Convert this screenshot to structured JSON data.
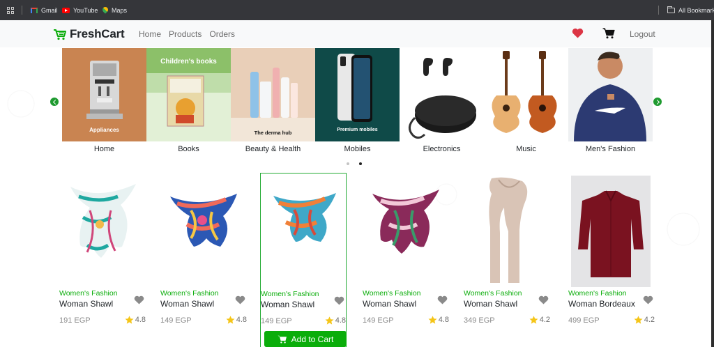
{
  "bookmarks_bar": {
    "items": [
      {
        "label": "Gmail",
        "icon": "gmail-icon"
      },
      {
        "label": "YouTube",
        "icon": "youtube-icon"
      },
      {
        "label": "Maps",
        "icon": "maps-icon"
      }
    ],
    "all_bookmarks": "All Bookmarks"
  },
  "navbar": {
    "brand": "FreshCart",
    "links": [
      "Home",
      "Products",
      "Orders"
    ],
    "logout": "Logout",
    "colors": {
      "brand": "#0aad0a",
      "heart": "#dc3545"
    }
  },
  "categories": {
    "items": [
      {
        "name": "Home",
        "image_caption": "Appliances"
      },
      {
        "name": "Books",
        "image_caption": "Children's books"
      },
      {
        "name": "Beauty & Health",
        "image_caption": "The derma hub"
      },
      {
        "name": "Mobiles",
        "image_caption": "Premium mobiles"
      },
      {
        "name": "Electronics",
        "image_caption": ""
      },
      {
        "name": "Music",
        "image_caption": ""
      },
      {
        "name": "Men's Fashion",
        "image_caption": ""
      }
    ],
    "slides": 2,
    "active_slide": 2
  },
  "products": [
    {
      "category": "Women's Fashion",
      "title": "Woman Shawl",
      "price": "191 EGP",
      "rating": "4.8"
    },
    {
      "category": "Women's Fashion",
      "title": "Woman Shawl",
      "price": "149 EGP",
      "rating": "4.8"
    },
    {
      "category": "Women's Fashion",
      "title": "Woman Shawl",
      "price": "149 EGP",
      "rating": "4.8",
      "hovered": true,
      "button": "Add to Cart"
    },
    {
      "category": "Women's Fashion",
      "title": "Woman Shawl",
      "price": "149 EGP",
      "rating": "4.8"
    },
    {
      "category": "Women's Fashion",
      "title": "Woman Shawl",
      "price": "349 EGP",
      "rating": "4.2"
    },
    {
      "category": "Women's Fashion",
      "title": "Woman Bordeaux",
      "price": "499 EGP",
      "rating": "4.2"
    }
  ]
}
